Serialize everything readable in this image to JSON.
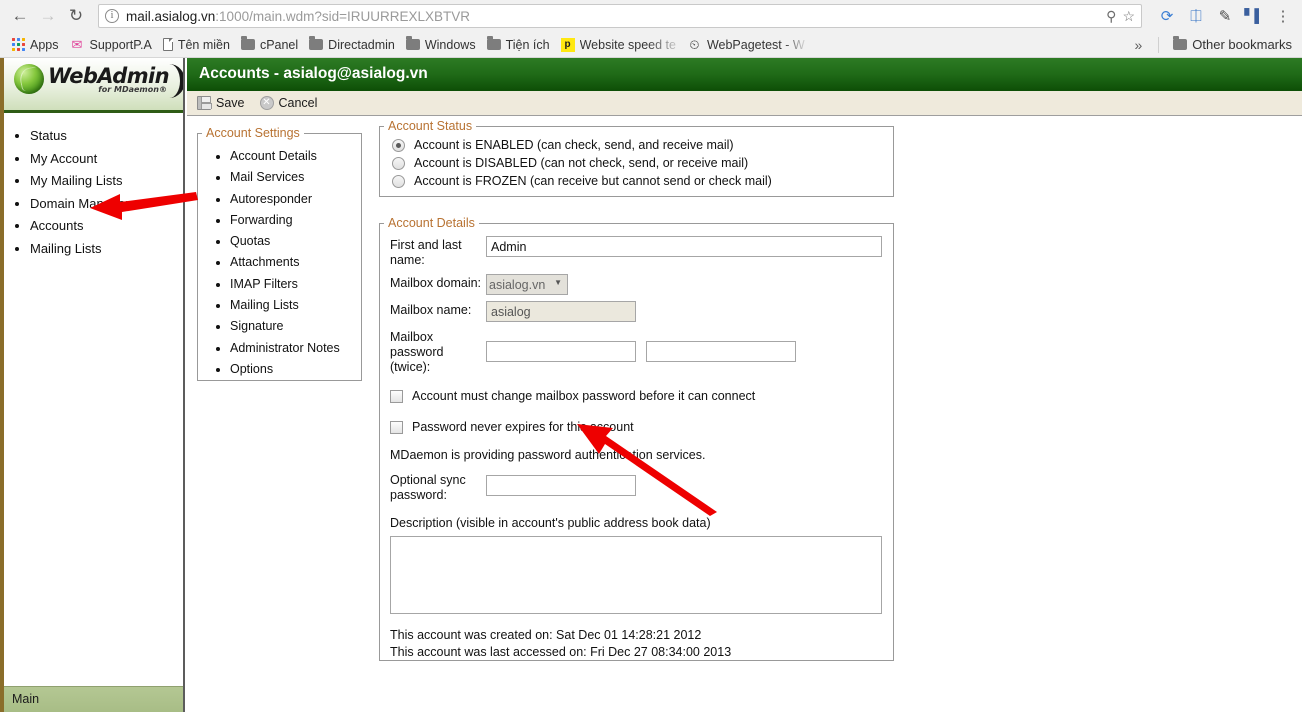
{
  "browser": {
    "nav": {
      "back_icon": "arrow-left-icon",
      "forward_icon": "arrow-right-icon",
      "reload_icon": "reload-icon"
    },
    "omnibox": {
      "info_icon": "info-circle-icon",
      "url_host": "mail.asialog.vn",
      "url_rest": ":1000/main.wdm?sid=IRUURREXLXBTVR",
      "full_url": "mail.asialog.vn:1000/main.wdm?sid=IRUURREXLXBTVR",
      "key_icon": "key-icon",
      "star_icon": "star-icon"
    },
    "extensions": [
      {
        "name": "extension-blue-refresh",
        "glyph": "↻",
        "color": "#3c7fd4"
      },
      {
        "name": "extension-blue-panel",
        "glyph": "⧉",
        "color": "#2f6fc4"
      },
      {
        "name": "extension-eyedropper",
        "glyph": "✒",
        "color": "#4a4a4a"
      },
      {
        "name": "extension-analytics",
        "glyph": "█",
        "color": "#3a5f9e"
      }
    ],
    "menu_icon": "kebab-menu-icon",
    "bookmarks": [
      {
        "label": "Apps",
        "icon": "apps-grid-icon",
        "faded": false
      },
      {
        "label": "SupportP.A",
        "icon": "support-icon",
        "faded": false
      },
      {
        "label": "Tên miền",
        "icon": "document-icon",
        "faded": false
      },
      {
        "label": "cPanel",
        "icon": "folder-icon",
        "faded": false
      },
      {
        "label": "Directadmin",
        "icon": "folder-icon",
        "faded": false
      },
      {
        "label": "Windows",
        "icon": "folder-icon",
        "faded": false
      },
      {
        "label": "Tiện ích",
        "icon": "folder-icon",
        "faded": false
      },
      {
        "label": "Website speed te",
        "icon": "pingdom-icon",
        "faded": true
      },
      {
        "label": "WebPagetest - W",
        "icon": "webpagetest-icon",
        "faded": true
      }
    ],
    "overflow_label": "»",
    "other_bookmarks": {
      "label": "Other bookmarks",
      "icon": "folder-icon"
    }
  },
  "sidebar": {
    "logo": {
      "title": "WebAdmin",
      "subtitle": "for MDaemon®",
      "globe_icon": "green-globe-icon"
    },
    "items": [
      {
        "label": "Status"
      },
      {
        "label": "My Account"
      },
      {
        "label": "My Mailing Lists"
      },
      {
        "label": "Domain Manager"
      },
      {
        "label": "Accounts"
      },
      {
        "label": "Mailing Lists"
      }
    ],
    "status_bar": {
      "label": "Main"
    }
  },
  "header": {
    "title": "Accounts - asialog@asialog.vn",
    "accent_color": "#1f6a17"
  },
  "toolbar": {
    "save_label": "Save",
    "save_icon": "floppy-disk-icon",
    "cancel_label": "Cancel",
    "cancel_icon": "cancel-circle-icon"
  },
  "account_settings": {
    "legend": "Account Settings",
    "items": [
      {
        "label": "Account Details"
      },
      {
        "label": "Mail Services"
      },
      {
        "label": "Autoresponder"
      },
      {
        "label": "Forwarding"
      },
      {
        "label": "Quotas"
      },
      {
        "label": "Attachments"
      },
      {
        "label": "IMAP Filters"
      },
      {
        "label": "Mailing Lists"
      },
      {
        "label": "Signature"
      },
      {
        "label": "Administrator Notes"
      },
      {
        "label": "Options"
      }
    ]
  },
  "account_status": {
    "legend": "Account Status",
    "options": [
      {
        "label": "Account is ENABLED (can check, send, and receive mail)",
        "selected": true
      },
      {
        "label": "Account is DISABLED (can not check, send, or receive mail)",
        "selected": false
      },
      {
        "label": "Account is FROZEN (can receive but cannot send or check mail)",
        "selected": false
      }
    ]
  },
  "account_details": {
    "legend": "Account Details",
    "first_last_name": {
      "label": "First and last name:",
      "value": "Admin"
    },
    "mailbox_domain": {
      "label": "Mailbox domain:",
      "value": "asialog.vn",
      "options": [
        "asialog.vn"
      ]
    },
    "mailbox_name": {
      "label": "Mailbox name:",
      "value": "asialog"
    },
    "mailbox_password": {
      "label": "Mailbox password (twice):",
      "value": "",
      "value2": ""
    },
    "must_change_password": {
      "label": "Account must change mailbox password before it can connect",
      "checked": false
    },
    "never_expires": {
      "label": "Password never expires for this account",
      "checked": false
    },
    "auth_note": "MDaemon is providing password authentication services.",
    "sync_password": {
      "label": "Optional sync password:",
      "value": ""
    },
    "description": {
      "label": "Description (visible in account's public address book data)",
      "value": ""
    },
    "created_on": "This account was created on: Sat Dec 01 14:28:21 2012",
    "last_accessed_on": "This account was last accessed on: Fri Dec 27 08:34:00 2013"
  },
  "annotations": {
    "arrow_color": "#ee0000",
    "arrow_1_target": "My Account",
    "arrow_2_target": "Mailbox password field"
  }
}
